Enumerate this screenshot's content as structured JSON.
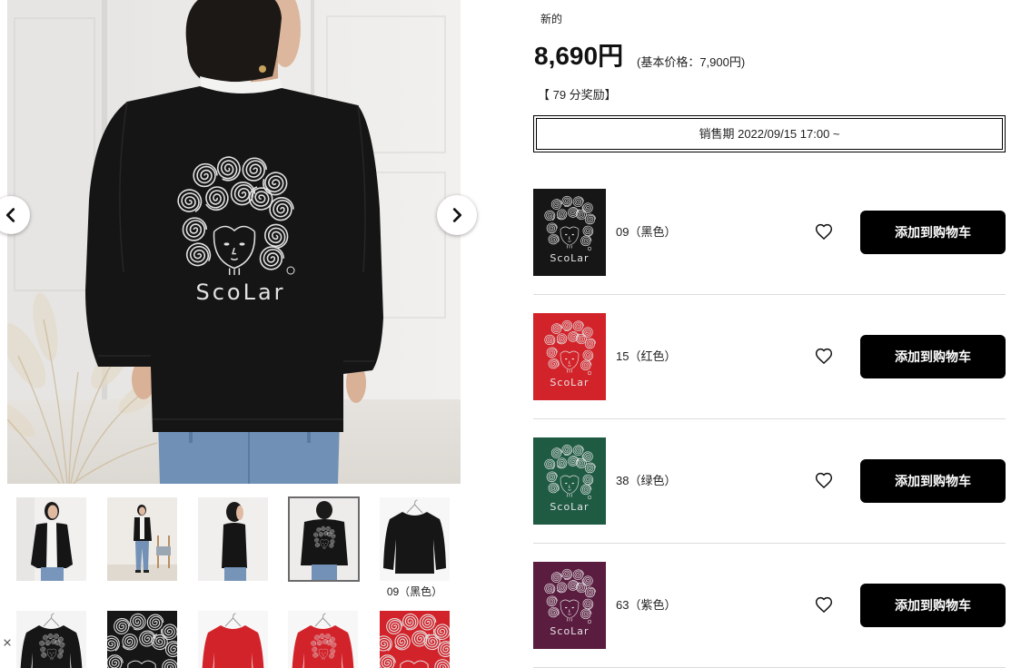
{
  "product": {
    "condition": "新的",
    "price": "8,690円",
    "base_price": "(基本价格：7,900円)",
    "points": "【 79 分奖励】",
    "sale_period": "销售期 2022/09/15 17:00 ~"
  },
  "gallery": {
    "selected_thumbnail": 4,
    "selected_caption": "09（黑色）",
    "graphic_text": "ScoLar"
  },
  "variants": [
    {
      "label": "09（黑色）",
      "color": "#161616",
      "button": "添加到购物车"
    },
    {
      "label": "15（红色）",
      "color": "#d3232a",
      "button": "添加到购物车"
    },
    {
      "label": "38（绿色）",
      "color": "#1f5b43",
      "button": "添加到购物车"
    },
    {
      "label": "63（紫色）",
      "color": "#5a1c3f",
      "button": "添加到购物车"
    }
  ],
  "icons": {
    "previous": "chevron-left-icon",
    "next": "chevron-right-icon",
    "wishlist": "heart-outline-icon",
    "close": "close-icon"
  },
  "colors": {
    "button_background": "#000000",
    "button_text": "#ffffff",
    "divider": "#dcdcdc",
    "selected_thumbnail_border": "#6b6b6b"
  }
}
